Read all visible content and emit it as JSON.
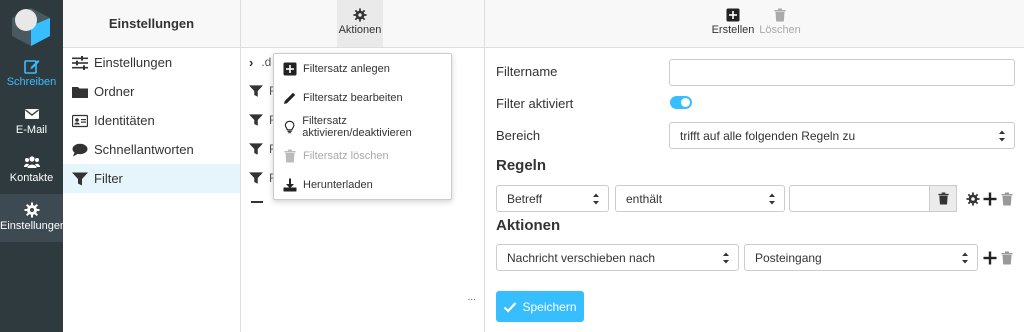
{
  "nav": {
    "items": [
      {
        "label": "Schreiben",
        "icon": "compose-icon"
      },
      {
        "label": "E-Mail",
        "icon": "envelope-icon"
      },
      {
        "label": "Kontakte",
        "icon": "contacts-icon"
      },
      {
        "label": "Einstellungen",
        "icon": "gear-icon"
      }
    ]
  },
  "settings": {
    "title": "Einstellungen",
    "items": [
      {
        "label": "Einstellungen",
        "icon": "sliders-icon"
      },
      {
        "label": "Ordner",
        "icon": "folder-icon"
      },
      {
        "label": "Identitäten",
        "icon": "id-card-icon"
      },
      {
        "label": "Schnellantworten",
        "icon": "comment-icon"
      },
      {
        "label": "Filter",
        "icon": "filter-icon"
      }
    ]
  },
  "filter_list": {
    "actions_label": "Aktionen",
    "first_row": ".d",
    "rows": [
      "F",
      "F",
      "F",
      "F"
    ],
    "ellipsis": "..."
  },
  "actions_menu": {
    "items": [
      {
        "label": "Filtersatz anlegen",
        "icon": "plus-square-icon",
        "disabled": false
      },
      {
        "label": "Filtersatz bearbeiten",
        "icon": "pencil-icon",
        "disabled": false
      },
      {
        "label": "Filtersatz aktivieren/deaktivieren",
        "icon": "lightbulb-icon",
        "disabled": false
      },
      {
        "label": "Filtersatz löschen",
        "icon": "trash-icon",
        "disabled": true
      },
      {
        "label": "Herunterladen",
        "icon": "download-icon",
        "disabled": false
      }
    ]
  },
  "toolbar": {
    "create_label": "Erstellen",
    "delete_label": "Löschen"
  },
  "form": {
    "filtername_label": "Filtername",
    "filtername_value": "",
    "active_label": "Filter aktiviert",
    "active": true,
    "scope_label": "Bereich",
    "scope_value": "trifft auf alle folgenden Regeln zu",
    "rules_title": "Regeln",
    "rule_field": "Betreff",
    "rule_operator": "enthält",
    "rule_value": "",
    "actions_title": "Aktionen",
    "action_type": "Nachricht verschieben nach",
    "action_target": "Posteingang",
    "save_label": "Speichern"
  },
  "colors": {
    "accent": "#37beff",
    "rail": "#2f3a3f",
    "selected_row": "#e6f4fb"
  }
}
